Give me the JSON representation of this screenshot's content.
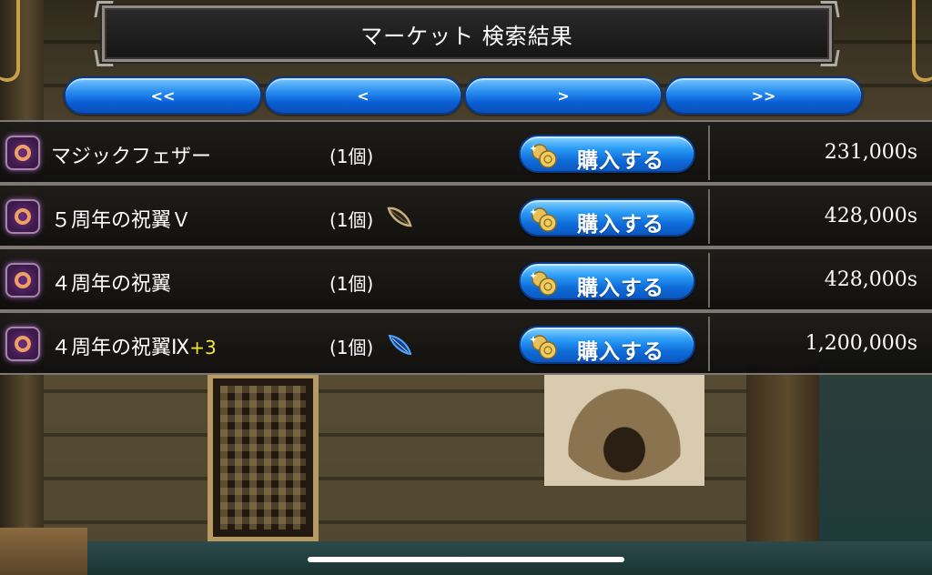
{
  "header": {
    "title": "マーケット 検索結果"
  },
  "nav": {
    "first_label": "<<",
    "prev_label": "<",
    "next_label": ">",
    "last_label": ">>"
  },
  "results": [
    {
      "name": "マジックフェザー",
      "plus": "",
      "qty": "(1個)",
      "feather": "",
      "buy_label": "購入する",
      "price": "231,000s"
    },
    {
      "name": "５周年の祝翼Ｖ",
      "plus": "",
      "qty": "(1個)",
      "feather": "brown-feather-icon",
      "buy_label": "購入する",
      "price": "428,000s"
    },
    {
      "name": "４周年の祝翼",
      "plus": "",
      "qty": "(1個)",
      "feather": "",
      "buy_label": "購入する",
      "price": "428,000s"
    },
    {
      "name": "４周年の祝翼Ⅸ",
      "plus": "+3",
      "qty": "(1個)",
      "feather": "blue-feather-icon",
      "buy_label": "購入する",
      "price": "1,200,000s"
    }
  ],
  "colors": {
    "button_blue": "#2a8ff0",
    "plus_yellow": "#f2e53a",
    "icon_purple": "#6a2f80"
  }
}
